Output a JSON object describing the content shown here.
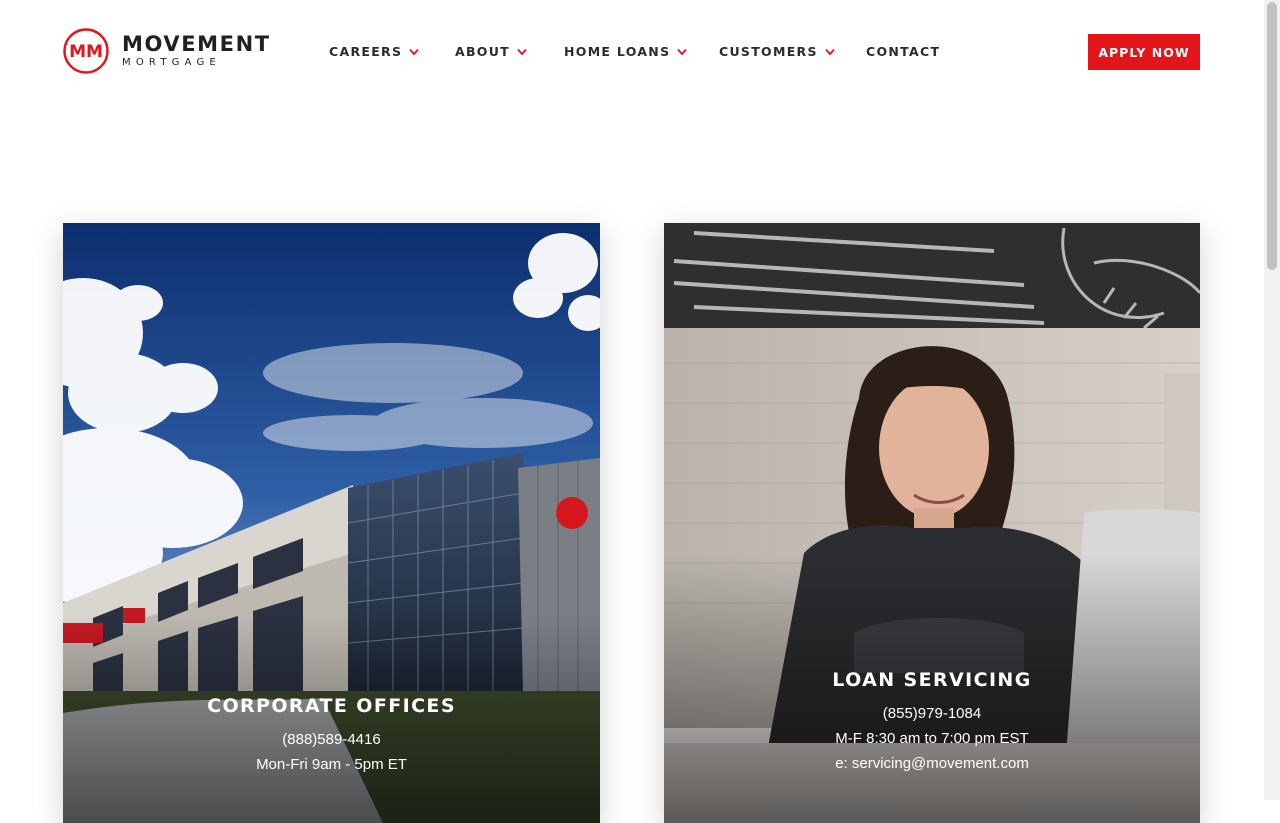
{
  "brand": {
    "name": "MOVEMENT",
    "sub": "MORTGAGE",
    "mark": "MM",
    "accent": "#e4141b"
  },
  "nav": {
    "items": [
      {
        "label": "CAREERS",
        "has_dropdown": true
      },
      {
        "label": "ABOUT",
        "has_dropdown": true
      },
      {
        "label": "HOME LOANS",
        "has_dropdown": true
      },
      {
        "label": "CUSTOMERS",
        "has_dropdown": true
      },
      {
        "label": "CONTACT",
        "has_dropdown": false
      }
    ],
    "apply_label": "APPLY NOW"
  },
  "cards": [
    {
      "title": "CORPORATE OFFICES",
      "phone": "(888)589-4416",
      "hours": "Mon-Fri 9am - 5pm ET",
      "image": "office-building-photo"
    },
    {
      "title": "LOAN SERVICING",
      "phone": "(855)979-1084",
      "hours": "M-F 8:30 am to 7:00 pm EST",
      "email": "e: servicing@movement.com",
      "image": "employee-at-laptop-photo"
    }
  ]
}
